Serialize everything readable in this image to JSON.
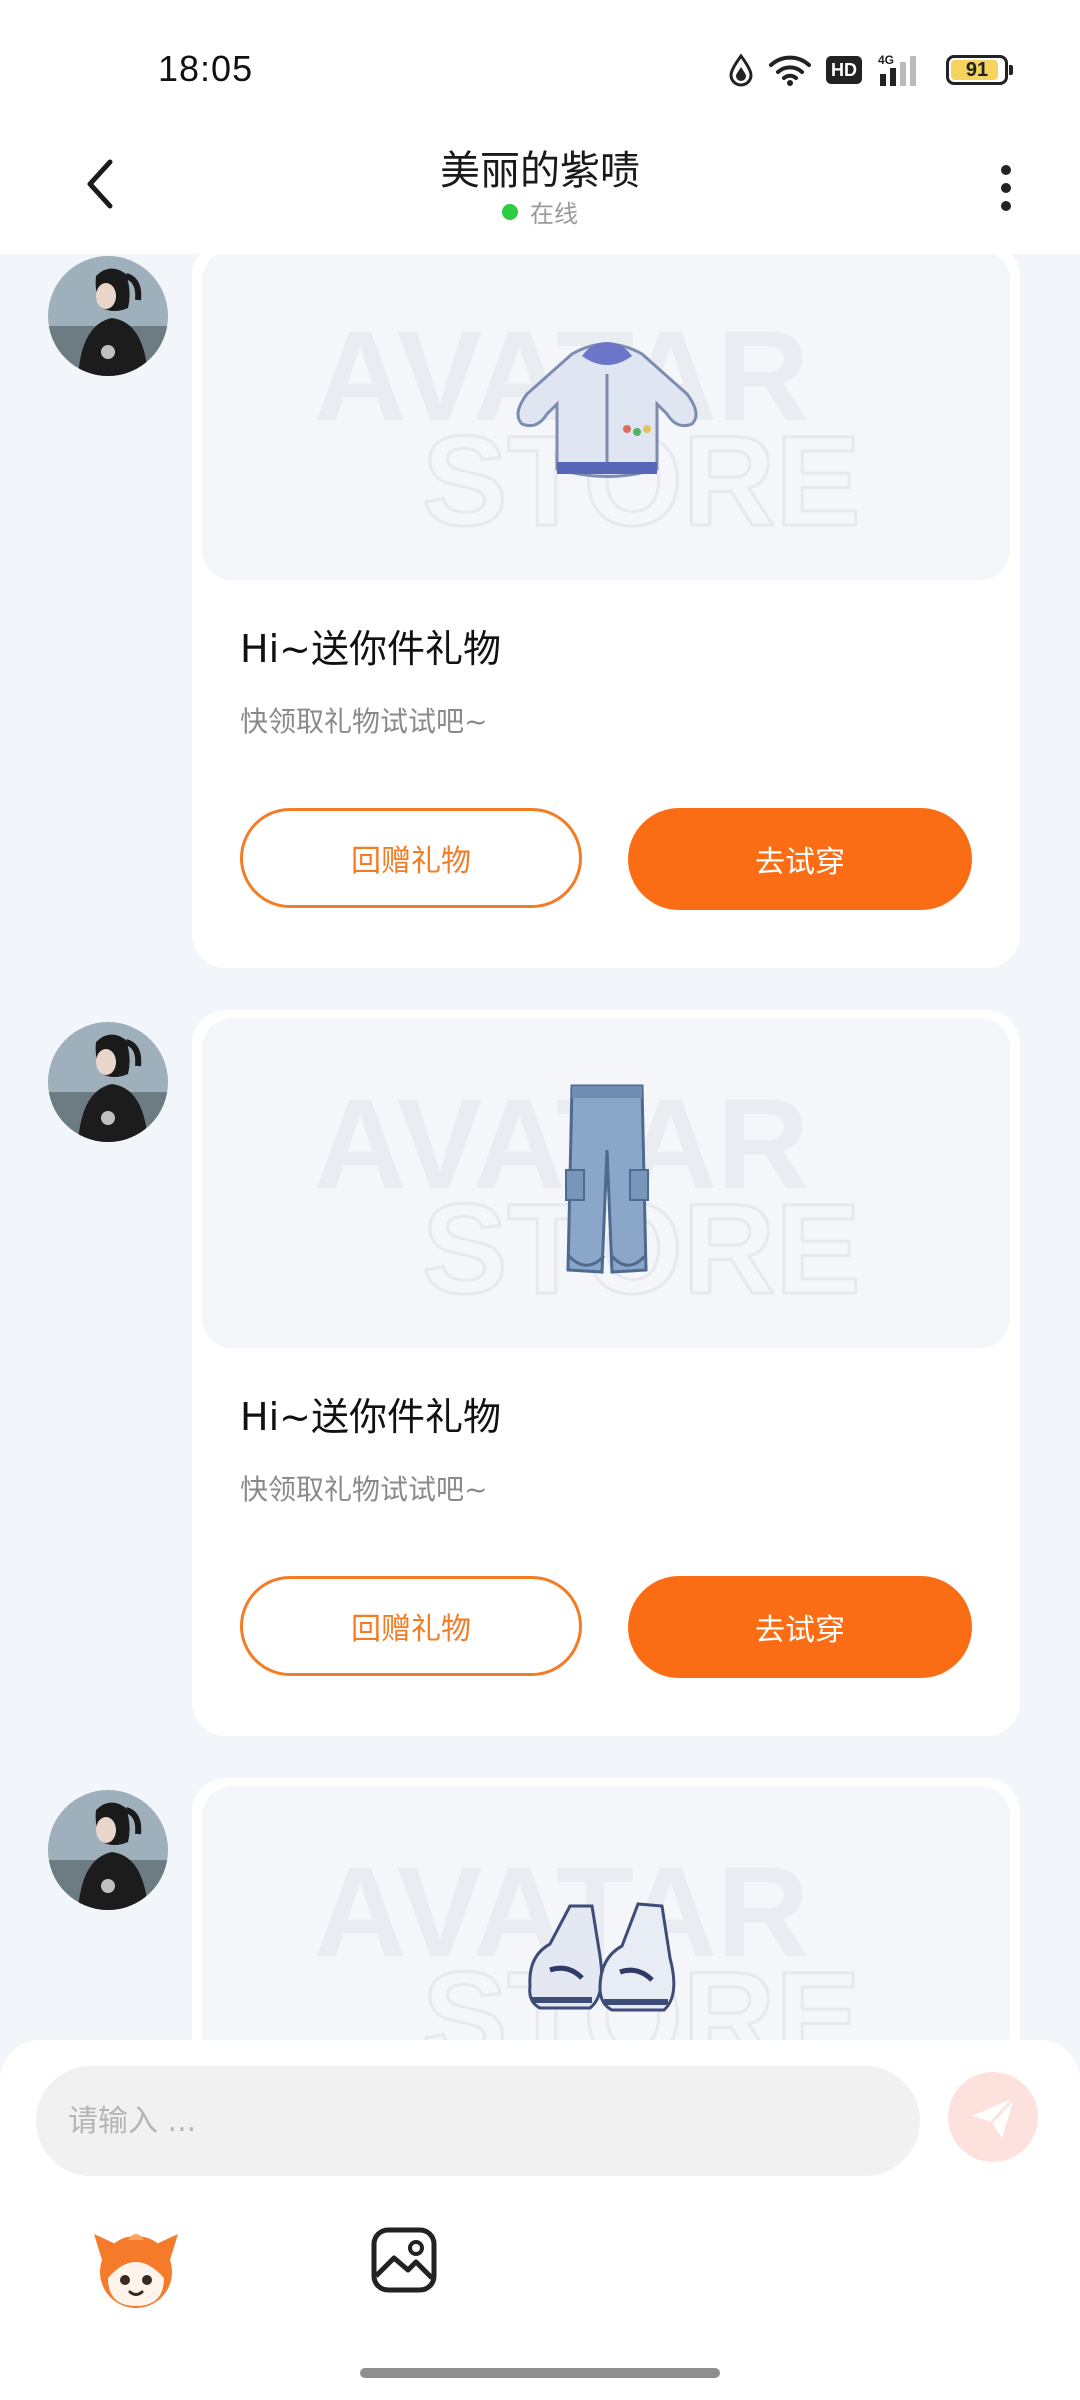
{
  "status_bar": {
    "time": "18:05",
    "network_label": "HD",
    "network_type": "4G",
    "battery_level": "91",
    "battery_percent": 91
  },
  "header": {
    "title": "美丽的紫啧",
    "status": "在线",
    "status_color": "#2ecc40"
  },
  "messages": [
    {
      "item": "hoodie",
      "watermark_line1": "AVATAR",
      "watermark_line2": "STORE",
      "title": "Hi~送你件礼物",
      "subtitle": "快领取礼物试试吧~",
      "return_label": "回赠礼物",
      "try_label": "去试穿"
    },
    {
      "item": "jeans",
      "watermark_line1": "AVATAR",
      "watermark_line2": "STORE",
      "title": "Hi~送你件礼物",
      "subtitle": "快领取礼物试试吧~",
      "return_label": "回赠礼物",
      "try_label": "去试穿"
    },
    {
      "item": "sneakers",
      "watermark_line1": "AVATAR",
      "watermark_line2": "STORE"
    }
  ],
  "input": {
    "placeholder": "请输入 ..."
  },
  "colors": {
    "accent": "#fb6d14",
    "page_bg": "#f2f5f9",
    "send_button_bg": "#fde1dd"
  },
  "icons": {
    "back": "chevron-left-icon",
    "more": "more-vertical-icon",
    "send": "send-icon",
    "mascot": "mascot-icon",
    "image": "image-icon"
  }
}
